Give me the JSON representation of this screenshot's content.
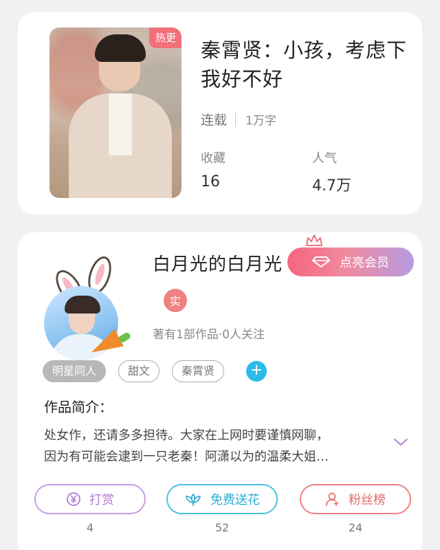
{
  "book": {
    "hot_badge": "热更",
    "title": "秦霄贤：小孩，考虑下我好不好",
    "status": "连载",
    "word_count": "1万字",
    "stats": [
      {
        "label": "收藏",
        "value": "16"
      },
      {
        "label": "人气",
        "value": "4.7万"
      }
    ]
  },
  "author": {
    "name": "白月光的白月光",
    "vip_label": "点亮会员",
    "real_badge": "实",
    "meta": "著有1部作品·0人关注"
  },
  "tags": [
    "明星同人",
    "甜文",
    "秦霄贤"
  ],
  "tag_add": "+",
  "intro": {
    "title": "作品简介：",
    "line1": "处女作，还请多多担待。大家在上网时要谨慎网聊，",
    "line2": "因为有可能会逮到一只老秦！阿潇以为的温柔大姐…"
  },
  "actions": [
    {
      "label": "打赏",
      "count": "4",
      "color": "#b57ad8",
      "icon": "yen-coin-icon"
    },
    {
      "label": "免费送花",
      "count": "52",
      "color": "#36b9dc",
      "icon": "flower-icon"
    },
    {
      "label": "粉丝榜",
      "count": "24",
      "color": "#ee6f70",
      "icon": "fans-person-icon"
    }
  ]
}
